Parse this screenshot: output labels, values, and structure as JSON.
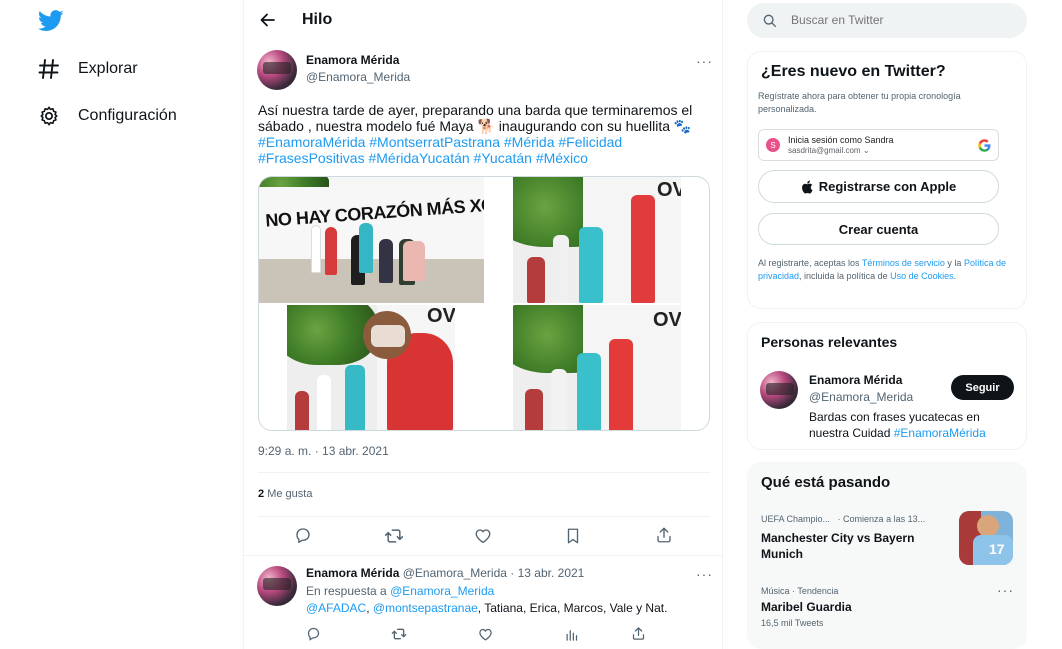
{
  "nav": {
    "items": [
      {
        "label": "Explorar",
        "icon": "hashtag-icon"
      },
      {
        "label": "Configuración",
        "icon": "gear-icon"
      }
    ]
  },
  "header": {
    "title": "Hilo"
  },
  "tweet": {
    "author_name": "Enamora Mérida",
    "author_handle": "@Enamora_Merida",
    "text_plain": "Así nuestra tarde de ayer, preparando una barda que terminaremos el sábado , nuestra modelo fué Maya 🐕 inaugurando con su huellita 🐾",
    "hashtags_line1": "#EnamoraMérida #MontserratPastrana #Mérida #Felicidad",
    "hashtags_line2": "#FrasesPositivas #MéridaYucatán #Yucatán #México",
    "wall_text": "NO HAY CORAZÓN MÁS XOHOCH QUE EL DE UN PEK",
    "wall_text_small": "OV",
    "timestamp": "9:29 a. m. · 13 abr. 2021",
    "likes_count": "2",
    "likes_label": "Me gusta"
  },
  "reply": {
    "author_name": "Enamora Mérida",
    "author_handle": "@Enamora_Merida",
    "date": "· 13 abr. 2021",
    "in_reply_prefix": "En respuesta a",
    "in_reply_handle": "@Enamora_Merida",
    "mention1": "@AFADAC",
    "separator": ",",
    "mention2": "@montsepastranae",
    "text_rest": ", Tatiana, Erica, Marcos, Vale y Nat."
  },
  "search": {
    "placeholder": "Buscar en Twitter"
  },
  "signup": {
    "title": "¿Eres nuevo en Twitter?",
    "subtitle": "Regístrate ahora para obtener tu propia cronología personalizada.",
    "google_line1": "Inicia sesión como Sandra",
    "google_line2": "sasdrita@gmail.com",
    "google_avatar": "S",
    "apple_label": "Registrarse con Apple",
    "create_label": "Crear cuenta",
    "legal_prefix": "Al registrarte, aceptas los ",
    "terms": "Términos de servicio",
    "legal_and": " y la ",
    "privacy": "Política de privacidad",
    "legal_mid": ", incluida la política de ",
    "cookies": "Uso de Cookies",
    "legal_end": "."
  },
  "relevant": {
    "title": "Personas relevantes",
    "name": "Enamora Mérida",
    "handle": "@Enamora_Merida",
    "follow_label": "Seguir",
    "bio_line1": "Bardas con frases yucatecas en",
    "bio_line2_text": "nuestra Cuidad ",
    "bio_line2_tag": "#EnamoraMérida"
  },
  "trends": {
    "title": "Qué está pasando",
    "items": [
      {
        "meta": "UEFA Champio...",
        "meta2": "· Comienza a las 13...",
        "title_line1": "Manchester City vs Bayern",
        "title_line2": "Munich",
        "thumb_number": "17"
      },
      {
        "meta": "Música · Tendencia",
        "title": "Maribel Guardia",
        "count": "16,5 mil Tweets"
      }
    ]
  },
  "colors": {
    "accent": "#1d9bf0",
    "text": "#0f1419",
    "muted": "#536471",
    "border": "#eff3f4"
  }
}
